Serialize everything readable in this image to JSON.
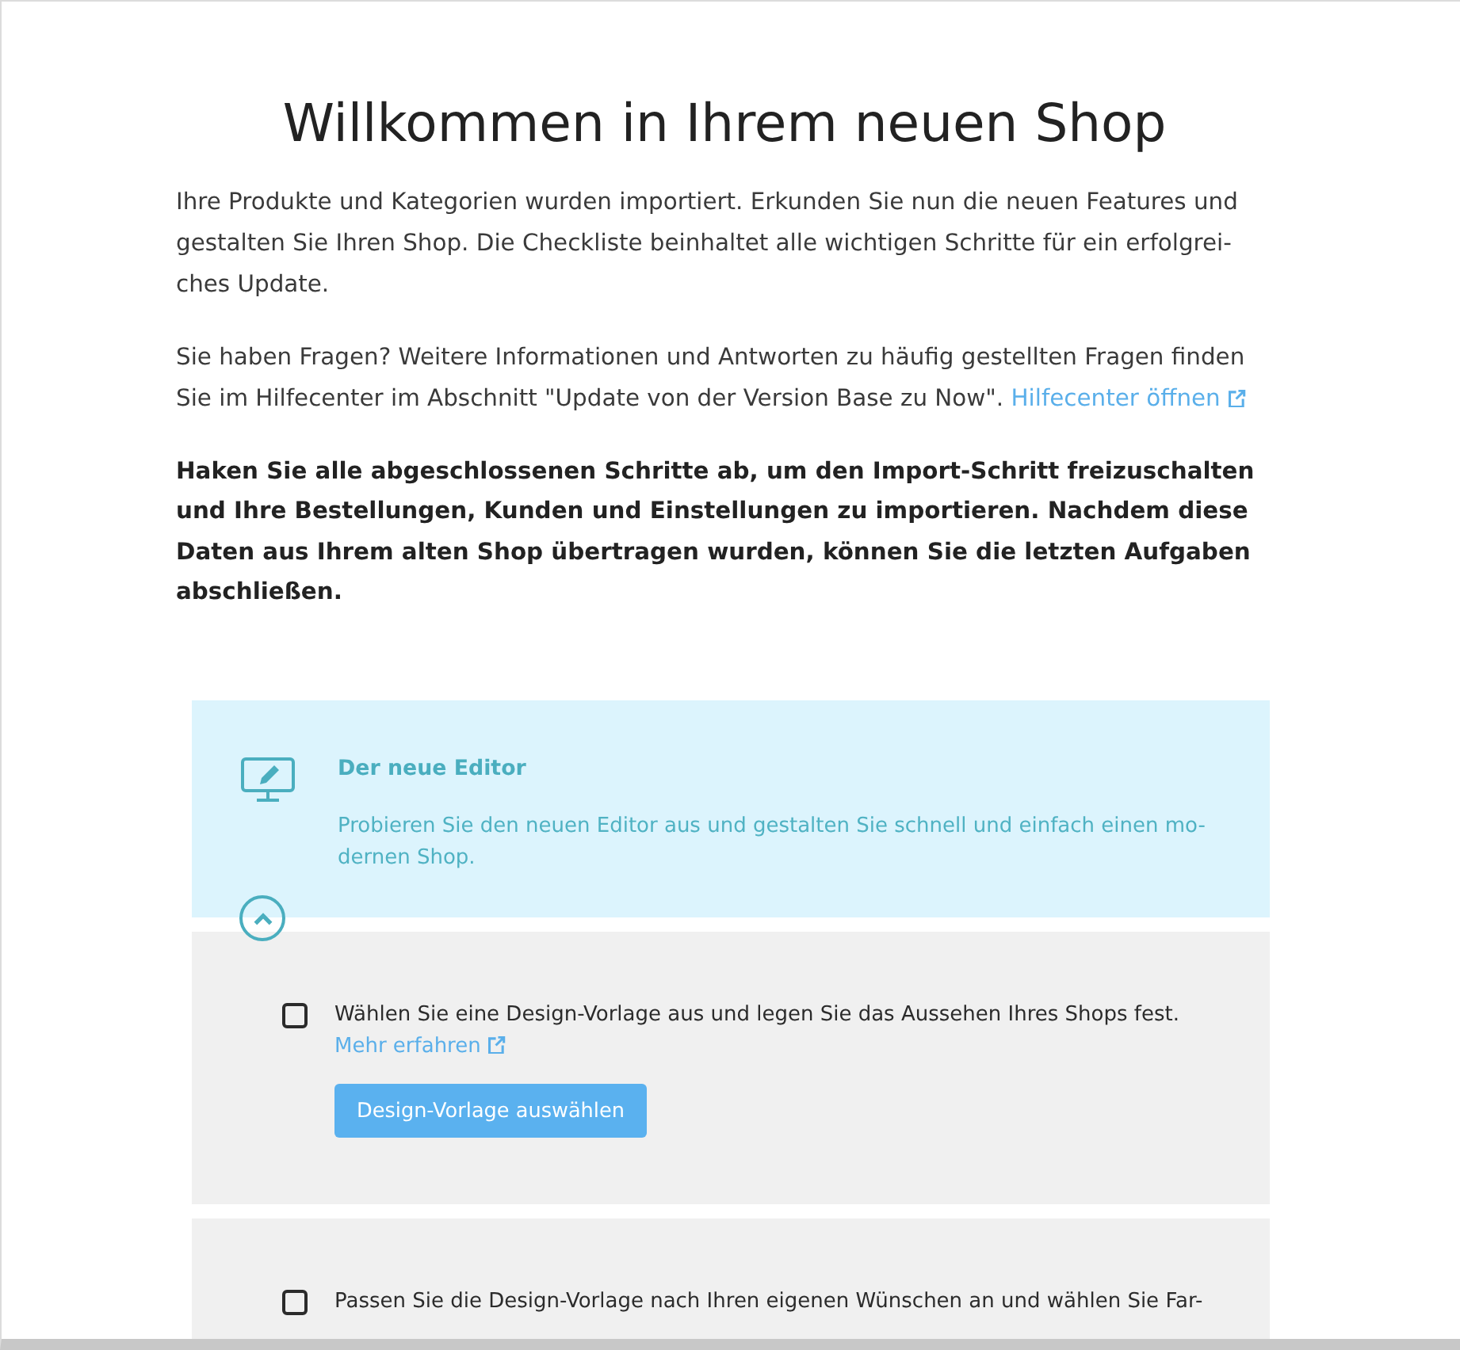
{
  "page": {
    "title": "Willkommen in Ihrem neuen Shop"
  },
  "intro": [
    {
      "text": "Ihre Produkte und Kategorien wurden importiert. Erkunden Sie nun die neuen Features und gestalten Sie Ihren Shop. Die Checkliste beinhaltet alle wichtigen Schritte für ein erfolgrei-ches Update."
    },
    {
      "text": "Sie haben Fragen? Weitere Informationen und Antworten zu häufig gestellten Fragen finden Sie im Hilfecenter im Abschnitt \"Update von der Version Base zu Now\".",
      "link": "Hilfecenter öffnen"
    }
  ],
  "instruction": "Haken Sie alle abgeschlossenen Schritte ab, um den Import-Schritt freizuschalten und Ihre Bestellungen, Kunden und Einstellungen zu importieren. Nachdem diese Daten aus Ihrem alten Shop übertragen wurden, können Sie die letzten Aufgaben abschließen.",
  "feature": {
    "title": "Der neue Editor",
    "description": "Probieren Sie den neuen Editor aus und gestalten Sie schnell und einfach einen mo-dernen Shop.",
    "expanded": true
  },
  "tasks": [
    {
      "text": "Wählen Sie eine Design-Vorlage aus und legen Sie das Aussehen Ihres Shops fest.",
      "checked": false,
      "link": "Mehr erfahren",
      "button": "Design-Vorlage auswählen"
    },
    {
      "text": "Passen Sie die Design-Vorlage nach Ihren eigenen Wünschen an und wählen Sie Far-",
      "checked": false
    }
  ]
}
